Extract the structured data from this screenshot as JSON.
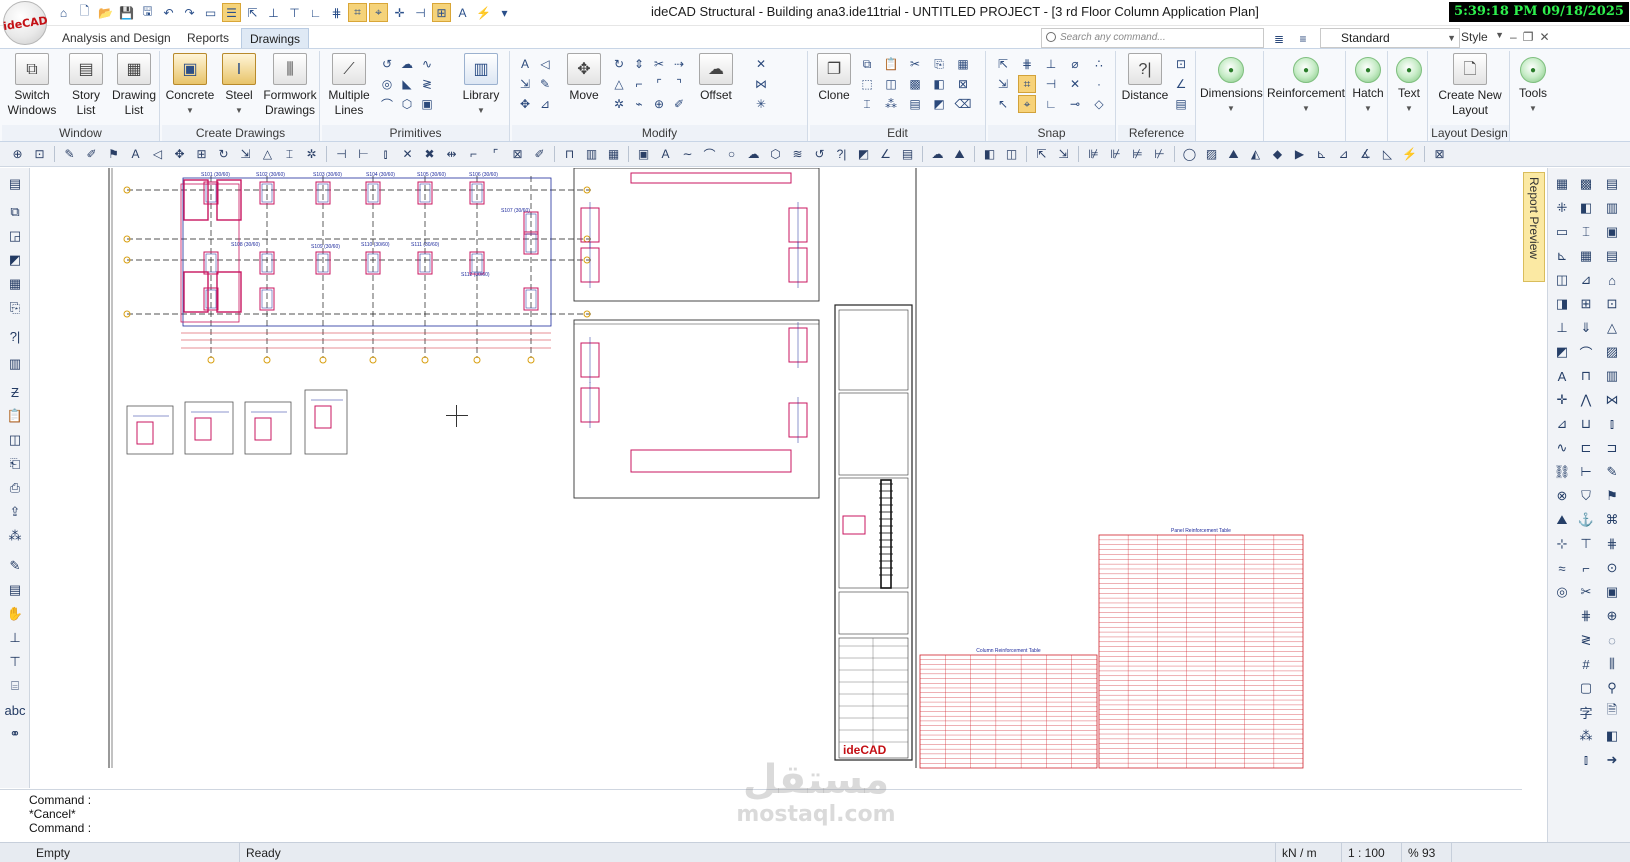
{
  "app": {
    "logo_text": "ideCAD",
    "window_title": "ideCAD Structural - Building ana3.ide11trial - UNTITLED PROJECT - [3 rd Floor Column Application Plan]",
    "clock": "5:39:18 PM 09/18/2025"
  },
  "tabs": [
    {
      "label": "Analysis and Design"
    },
    {
      "label": "Reports"
    },
    {
      "label": "Drawings"
    }
  ],
  "search": {
    "placeholder": "Search any command..."
  },
  "style_combo": {
    "value": "Standard",
    "label": "Style"
  },
  "ribbon": {
    "window_group": {
      "label": "Window",
      "switch_windows": "Switch Windows",
      "story_list": "Story List",
      "drawing_list": "Drawing List"
    },
    "create_group": {
      "label": "Create Drawings",
      "concrete": "Concrete",
      "steel": "Steel",
      "formwork": "Formwork Drawings"
    },
    "primitives_group": {
      "label": "Primitives",
      "multiple_lines": "Multiple Lines",
      "library": "Library"
    },
    "modify_group": {
      "label": "Modify",
      "move": "Move",
      "offset": "Offset"
    },
    "edit_group": {
      "label": "Edit",
      "clone": "Clone"
    },
    "snap_group": {
      "label": "Snap"
    },
    "reference_group": {
      "label": "Reference",
      "distance": "Distance"
    },
    "dimensions": "Dimensions",
    "reinforcement": "Reinforcement",
    "hatch": "Hatch",
    "text": "Text",
    "layout_group": {
      "label": "Layout Design",
      "create_new_layout": "Create New Layout"
    },
    "tools": "Tools"
  },
  "report_preview": "Report Preview",
  "commands": [
    {
      "text": "Command :"
    },
    {
      "text": "*Cancel*"
    },
    {
      "text": "Command :"
    }
  ],
  "status": {
    "left": "Empty",
    "state": "Ready",
    "units": "kN / m",
    "scale": "1 : 100",
    "zoom": "% 93"
  },
  "watermark": {
    "arabic": "مستقل",
    "latin": "mostaql.com"
  },
  "drawing": {
    "title_block_logo": "ideCAD",
    "column_table_title": "Column Reinforcement Table",
    "panel_table_title": "Panel Reinforcement Table",
    "column_labels": [
      "S101 (30/60)",
      "S102 (30/60)",
      "S103 (30/60)",
      "S104 (30/60)",
      "S105 (30/60)",
      "S106 (30/60)",
      "S107 (30/60)",
      "S108 (30/60)",
      "S109 (30/60)",
      "S110 (30/60)",
      "S111 (30/60)",
      "S112 (30/60)"
    ],
    "colors": {
      "reinforcement": "#c8155f",
      "linework": "#1d2a9c",
      "table": "#d0202a",
      "axis": "#1a1a1a",
      "bubble": "#d9a012"
    }
  }
}
